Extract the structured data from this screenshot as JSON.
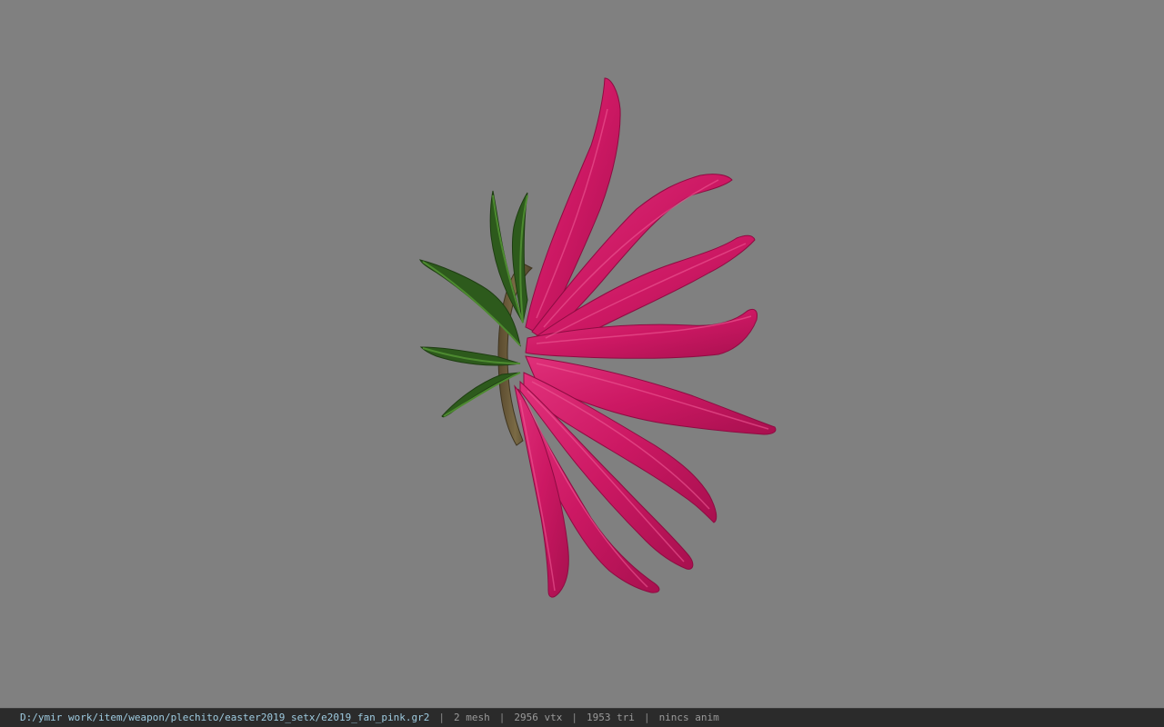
{
  "viewport": {
    "background": "#808080",
    "model": "pink fan weapon",
    "petal_color": "#d21b6c",
    "leaf_color": "#2d5a1c",
    "handle_color": "#6b5a3a"
  },
  "statusbar": {
    "path": "D:/ymir work/item/weapon/plechito/easter2019_setx/e2019_fan_pink.gr2",
    "separator": "|",
    "mesh": "2 mesh",
    "vtx": "2956 vtx",
    "tri": "1953 tri",
    "anim": "nincs anim",
    "path_color": "#9ecbe0",
    "text_color": "#9a9a9a"
  }
}
